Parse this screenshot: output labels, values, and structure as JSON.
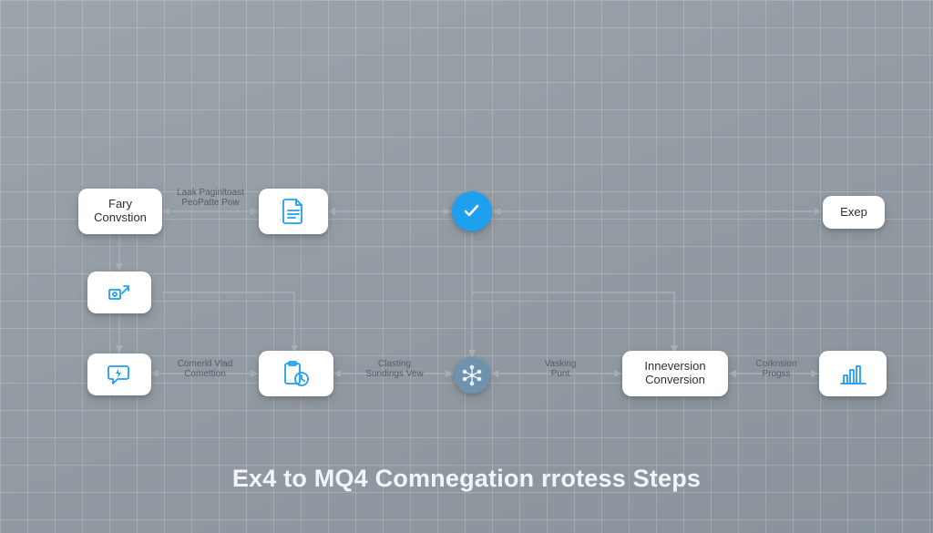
{
  "title": "Ex4 to MQ4 Comnegation rrotess Steps",
  "colors": {
    "accent": "#1e9ff0",
    "hub": "#6f92ad",
    "node_bg": "#ffffff"
  },
  "nodes": {
    "fary_convstion": {
      "label": "Fary\nConvstion"
    },
    "exep": {
      "label": "Exep"
    },
    "inneversion_conversion": {
      "label": "Inneversion\nConversion"
    }
  },
  "icons": {
    "referral": "referral-icon",
    "comment_bolt": "comment-bolt-icon",
    "document_lines": "document-lines-icon",
    "clipboard_clock": "clipboard-clock-icon",
    "check_circle": "check-circle-icon",
    "network_hub": "network-hub-icon",
    "bar_chart": "bar-chart-icon"
  },
  "edge_labels": {
    "laak": "Laak Paginltoast\nPeoPatte Pow",
    "comerld": "Comerld Vlad\nComettion",
    "clasting": "Clasting\nSundings Vew",
    "vasking": "Vasking\nPunt",
    "corknsion": "Corknsion\nProgss"
  }
}
